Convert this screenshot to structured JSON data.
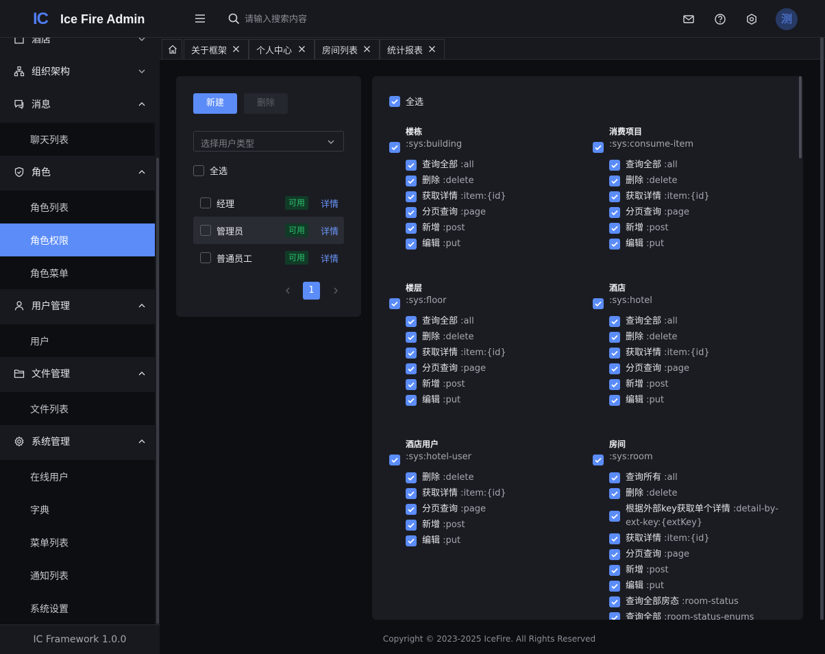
{
  "header": {
    "logo_mark": "IC",
    "app_title": "Ice Fire Admin",
    "search_placeholder": "请输入搜索内容",
    "avatar_text": "测"
  },
  "sidebar": {
    "partial_item": "酒店",
    "items": [
      {
        "label": "组织架构",
        "icon": "org-chart-icon",
        "expanded": false
      },
      {
        "label": "消息",
        "icon": "message-icon",
        "expanded": true,
        "children": [
          "聊天列表"
        ]
      },
      {
        "label": "角色",
        "icon": "shield-icon",
        "expanded": true,
        "children": [
          "角色列表",
          "角色权限",
          "角色菜单"
        ]
      },
      {
        "label": "用户管理",
        "icon": "user-icon",
        "expanded": true,
        "children": [
          "用户"
        ]
      },
      {
        "label": "文件管理",
        "icon": "folder-icon",
        "expanded": true,
        "children": [
          "文件列表"
        ]
      },
      {
        "label": "系统管理",
        "icon": "gear-icon",
        "expanded": true,
        "children": [
          "在线用户",
          "字典",
          "菜单列表",
          "通知列表",
          "系统设置"
        ]
      }
    ],
    "active_item": "角色权限",
    "footer": "IC Framework 1.0.0"
  },
  "tabs": [
    "关于框架",
    "个人中心",
    "房间列表",
    "统计报表"
  ],
  "roles_panel": {
    "new_button": "新建",
    "delete_button": "删除",
    "user_type_placeholder": "选择用户类型",
    "select_all": "全选",
    "roles": [
      {
        "name": "经理",
        "status": "可用",
        "detail": "详情"
      },
      {
        "name": "管理员",
        "status": "可用",
        "detail": "详情",
        "highlighted": true
      },
      {
        "name": "普通员工",
        "status": "可用",
        "detail": "详情"
      }
    ],
    "page": "1"
  },
  "permissions": {
    "select_all": "全选",
    "groups": [
      {
        "name": "楼栋",
        "key": ":sys:building",
        "perms": [
          {
            "label": "查询全部",
            "key": ":all"
          },
          {
            "label": "删除",
            "key": ":delete"
          },
          {
            "label": "获取详情",
            "key": ":item:{id}"
          },
          {
            "label": "分页查询",
            "key": ":page"
          },
          {
            "label": "新增",
            "key": ":post"
          },
          {
            "label": "编辑",
            "key": ":put"
          }
        ]
      },
      {
        "name": "消费项目",
        "key": ":sys:consume-item",
        "perms": [
          {
            "label": "查询全部",
            "key": ":all"
          },
          {
            "label": "删除",
            "key": ":delete"
          },
          {
            "label": "获取详情",
            "key": ":item:{id}"
          },
          {
            "label": "分页查询",
            "key": ":page"
          },
          {
            "label": "新增",
            "key": ":post"
          },
          {
            "label": "编辑",
            "key": ":put"
          }
        ]
      },
      {
        "name": "楼层",
        "key": ":sys:floor",
        "perms": [
          {
            "label": "查询全部",
            "key": ":all"
          },
          {
            "label": "删除",
            "key": ":delete"
          },
          {
            "label": "获取详情",
            "key": ":item:{id}"
          },
          {
            "label": "分页查询",
            "key": ":page"
          },
          {
            "label": "新增",
            "key": ":post"
          },
          {
            "label": "编辑",
            "key": ":put"
          }
        ]
      },
      {
        "name": "酒店",
        "key": ":sys:hotel",
        "perms": [
          {
            "label": "查询全部",
            "key": ":all"
          },
          {
            "label": "删除",
            "key": ":delete"
          },
          {
            "label": "获取详情",
            "key": ":item:{id}"
          },
          {
            "label": "分页查询",
            "key": ":page"
          },
          {
            "label": "新增",
            "key": ":post"
          },
          {
            "label": "编辑",
            "key": ":put"
          }
        ]
      },
      {
        "name": "酒店用户",
        "key": ":sys:hotel-user",
        "perms": [
          {
            "label": "删除",
            "key": ":delete"
          },
          {
            "label": "获取详情",
            "key": ":item:{id}"
          },
          {
            "label": "分页查询",
            "key": ":page"
          },
          {
            "label": "新增",
            "key": ":post"
          },
          {
            "label": "编辑",
            "key": ":put"
          }
        ]
      },
      {
        "name": "房间",
        "key": ":sys:room",
        "perms": [
          {
            "label": "查询所有",
            "key": ":all"
          },
          {
            "label": "删除",
            "key": ":delete"
          },
          {
            "label": "根据外部key获取单个详情",
            "key": ":detail-by-ext-key:{extKey}"
          },
          {
            "label": "获取详情",
            "key": ":item:{id}"
          },
          {
            "label": "分页查询",
            "key": ":page"
          },
          {
            "label": "新增",
            "key": ":post"
          },
          {
            "label": "编辑",
            "key": ":put"
          },
          {
            "label": "查询全部房态",
            "key": ":room-status"
          },
          {
            "label": "查询全部",
            "key": ":room-status-enums"
          }
        ]
      }
    ]
  },
  "footer": {
    "copyright": "Copyright © 2023-2025 IceFire. All Rights Reserved"
  },
  "colors": {
    "accent": "#5b8cf8",
    "status_green": "#2dbf6e",
    "bg": "#0d0e12",
    "panel": "#1b1c22"
  }
}
